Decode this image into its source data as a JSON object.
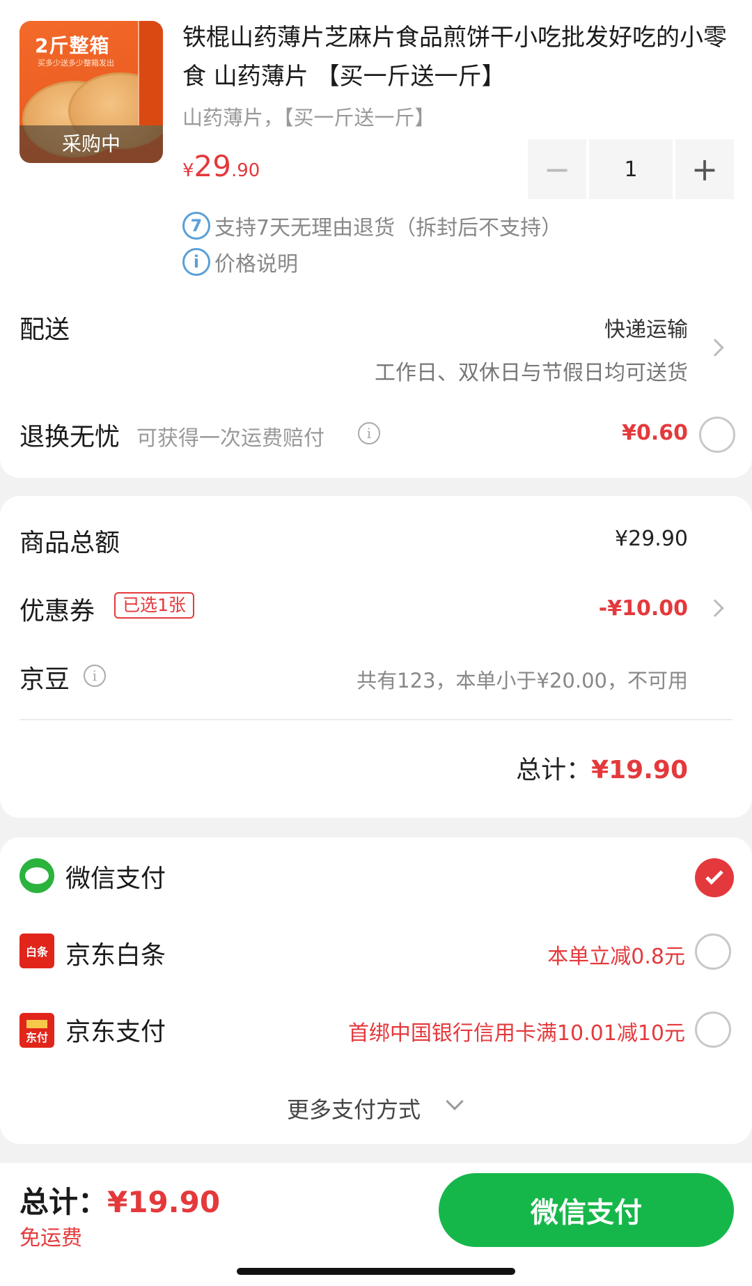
{
  "product": {
    "thumb_title": "2斤整箱",
    "thumb_sub": "买多少送多少整箱发出",
    "status": "采购中",
    "title": "铁棍山药薄片芝麻片食品煎饼干小吃批发好吃的小零食 山药薄片 【买一斤送一斤】",
    "spec": "山药薄片，【买一斤送一斤】",
    "price_yen": "¥",
    "price_int": "29",
    "price_dec": ".90",
    "quantity": "1",
    "minus": "−",
    "plus": "+",
    "return_badge": "7",
    "return_text": "支持7天无理由退货（拆封后不支持）",
    "price_info_badge": "i",
    "price_info_text": "价格说明"
  },
  "delivery": {
    "label": "配送",
    "method": "快递运输",
    "note": "工作日、双休日与节假日均可送货"
  },
  "insurance": {
    "label": "退换无忧",
    "sub": "可获得一次运费赔付",
    "info": "i",
    "price": "¥0.60"
  },
  "amounts": {
    "goods_label": "商品总额",
    "goods_value": "¥29.90",
    "coupon_label": "优惠券",
    "coupon_tag": "已选1张",
    "coupon_value": "-¥10.00",
    "bean_label": "京豆",
    "bean_info": "i",
    "bean_note": "共有123，本单小于¥20.00，不可用",
    "total_label": "总计：",
    "total_value": "¥19.90"
  },
  "payment": {
    "methods": [
      {
        "label": "微信支付",
        "promo": "",
        "selected": true
      },
      {
        "label": "京东白条",
        "promo": "本单立减0.8元",
        "selected": false,
        "icon_text": "白条"
      },
      {
        "label": "京东支付",
        "promo": "首绑中国银行信用卡满10.01减10元",
        "selected": false,
        "icon_text": "东付"
      }
    ],
    "more": "更多支付方式"
  },
  "bottom": {
    "total_label": "总计：",
    "total_value": "¥19.90",
    "free_shipping": "免运费",
    "pay_button": "微信支付"
  },
  "colors": {
    "accent_red": "#e4393c",
    "wechat_green": "#16b74a"
  }
}
